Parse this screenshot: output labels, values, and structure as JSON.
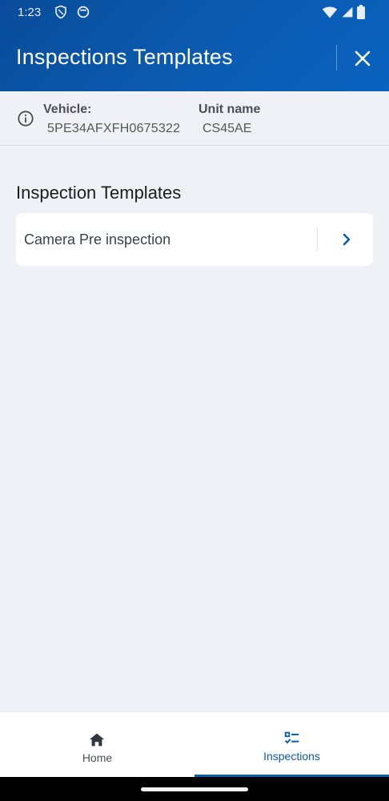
{
  "status_bar": {
    "time": "1:23",
    "icons_left": [
      "shield-icon",
      "circle-badge-icon"
    ],
    "icons_right": [
      "wifi-icon",
      "signal-icon",
      "battery-icon"
    ]
  },
  "header": {
    "title": "Inspections Templates",
    "close_icon": "close-icon",
    "background": "#0b5cb3"
  },
  "vehicle_info": {
    "icon": "info-icon",
    "vehicle_label": "Vehicle:",
    "vehicle_value": "5PE34AFXFH0675322",
    "unit_label": "Unit name",
    "unit_value": "CS45AE"
  },
  "section": {
    "title": "Inspection Templates",
    "templates": [
      {
        "name": "Camera Pre inspection",
        "icon": "chevron-right-icon"
      }
    ]
  },
  "bottom_nav": {
    "items": [
      {
        "label": "Home",
        "icon": "home-icon",
        "active": false
      },
      {
        "label": "Inspections",
        "icon": "checklist-icon",
        "active": true
      }
    ],
    "accent": "#0b5cab"
  }
}
